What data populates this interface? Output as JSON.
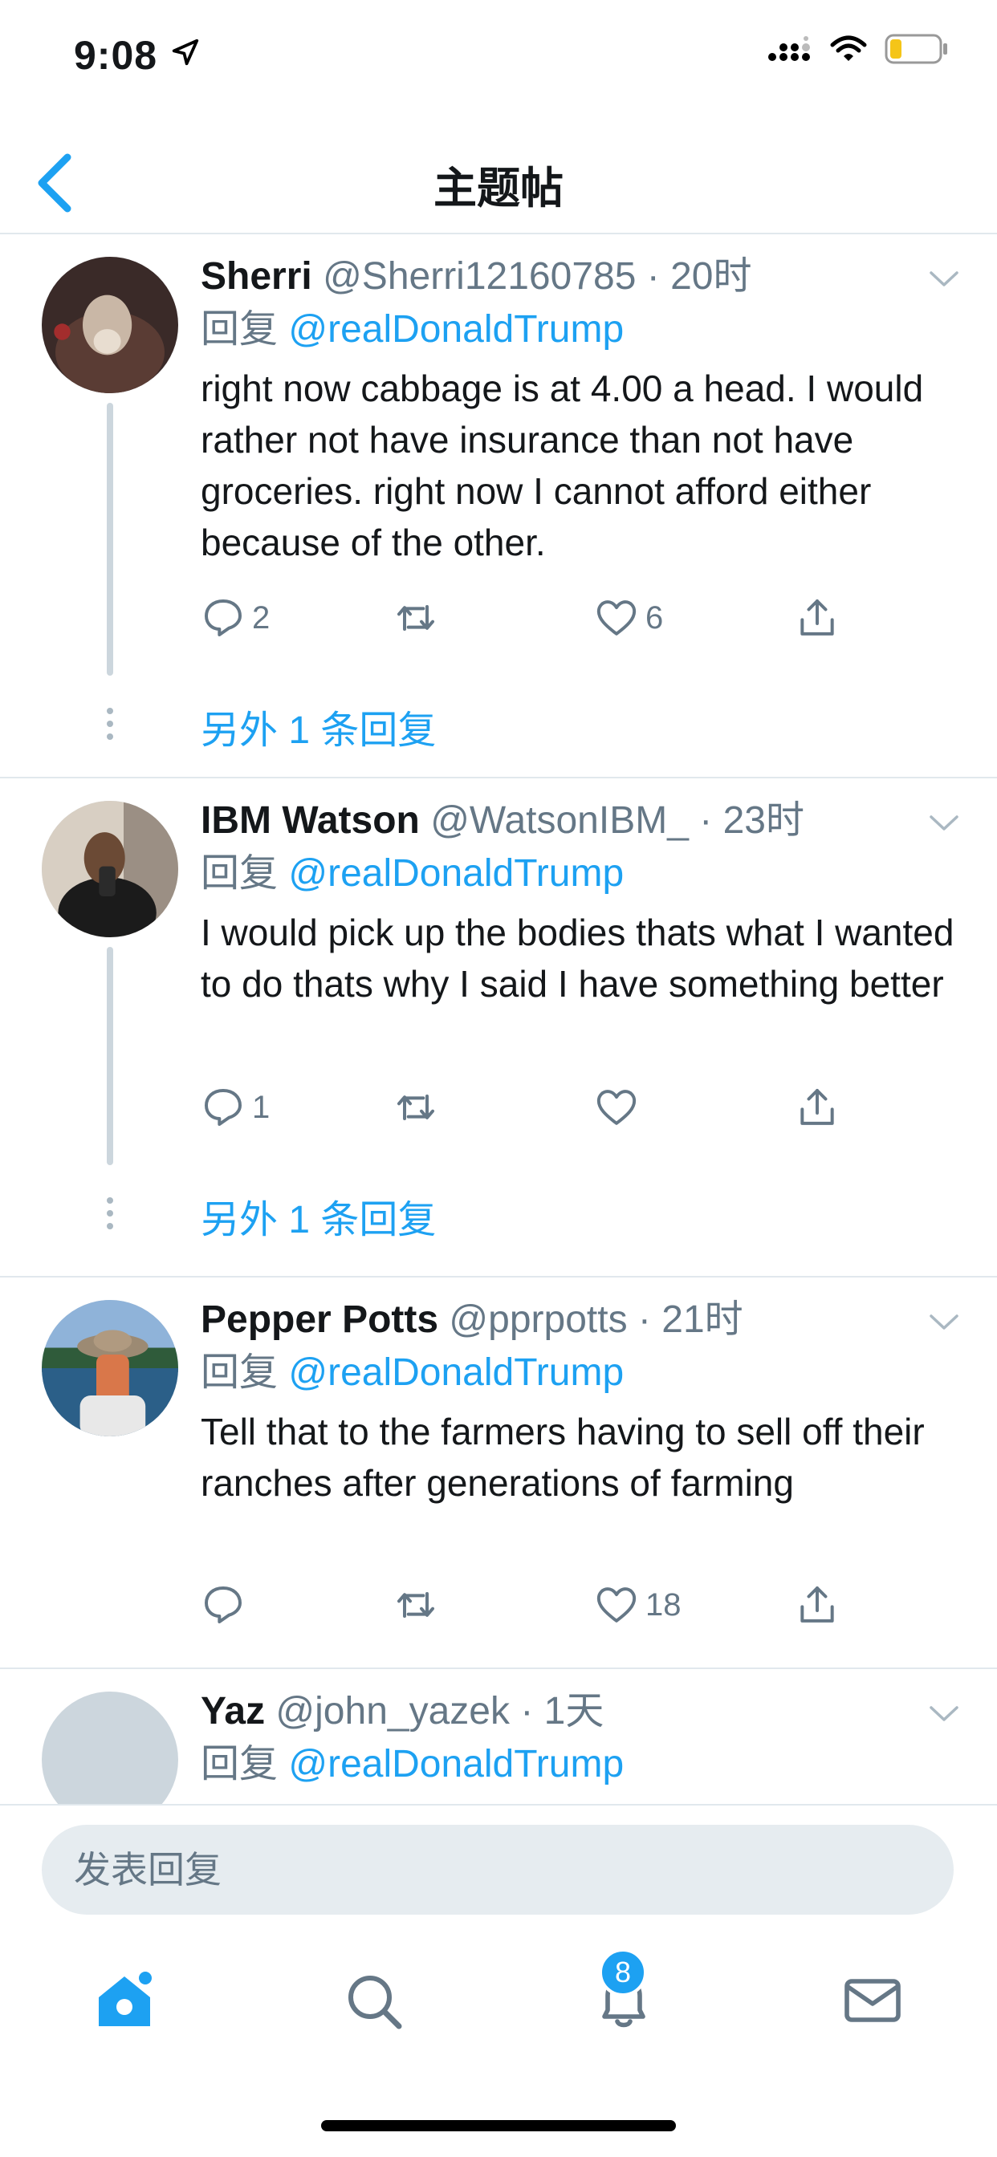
{
  "status_bar": {
    "time": "9:08"
  },
  "nav": {
    "title": "主题帖"
  },
  "tweets": [
    {
      "name": "Sherri",
      "handle": "@Sherri12160785",
      "time": "20时",
      "reply_prefix": "回复",
      "reply_to": "@realDonaldTrump",
      "text": "right now cabbage is at 4.00 a head. I would rather not have insurance than not have groceries. right now I cannot afford either because of the other.",
      "replies": "2",
      "retweets": "",
      "likes": "6",
      "more_replies": "另外 1 条回复"
    },
    {
      "name": "IBM Watson",
      "handle": "@WatsonIBM_",
      "time": "23时",
      "reply_prefix": "回复",
      "reply_to": "@realDonaldTrump",
      "text": "I would pick up the bodies thats what I wanted to do thats why I said I have something better",
      "replies": "1",
      "retweets": "",
      "likes": "",
      "more_replies": "另外 1 条回复"
    },
    {
      "name": "Pepper Potts",
      "handle": "@pprpotts",
      "time": "21时",
      "reply_prefix": "回复",
      "reply_to": "@realDonaldTrump",
      "text": "Tell that to the farmers having to sell off their ranches after generations of farming",
      "replies": "",
      "retweets": "",
      "likes": "18"
    },
    {
      "name": "Yaz",
      "handle": "@john_yazek",
      "time": "1天",
      "reply_prefix": "回复",
      "reply_to": "@realDonaldTrump"
    }
  ],
  "composer": {
    "placeholder": "发表回复"
  },
  "tabbar": {
    "notifications_badge": "8"
  },
  "colors": {
    "accent": "#1da1f2",
    "muted": "#657786",
    "divider": "#e1e8ed"
  }
}
